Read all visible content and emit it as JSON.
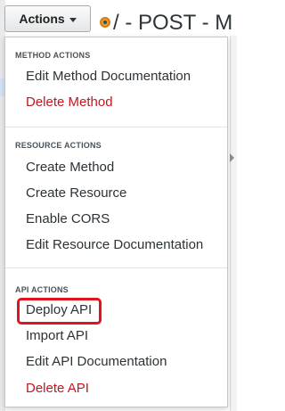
{
  "toolbar": {
    "actions_label": "Actions"
  },
  "header": {
    "title": "/ - POST - M"
  },
  "menu": {
    "method_actions": {
      "heading": "METHOD ACTIONS",
      "items": [
        "Edit Method Documentation",
        "Delete Method"
      ]
    },
    "resource_actions": {
      "heading": "RESOURCE ACTIONS",
      "items": [
        "Create Method",
        "Create Resource",
        "Enable CORS",
        "Edit Resource Documentation"
      ]
    },
    "api_actions": {
      "heading": "API ACTIONS",
      "items": [
        "Deploy API",
        "Import API",
        "Edit API Documentation",
        "Delete API"
      ]
    }
  },
  "colors": {
    "danger": "#c5161d",
    "highlight": "#e0141e",
    "method_badge": "#f49a1f"
  }
}
